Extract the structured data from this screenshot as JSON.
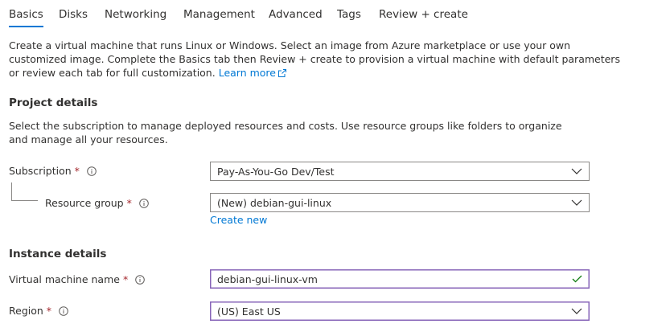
{
  "tabs": [
    {
      "label": "Basics",
      "active": true
    },
    {
      "label": "Disks"
    },
    {
      "label": "Networking"
    },
    {
      "label": "Management"
    },
    {
      "label": "Advanced"
    },
    {
      "label": "Tags"
    },
    {
      "label": "Review + create"
    }
  ],
  "intro": {
    "text": "Create a virtual machine that runs Linux or Windows. Select an image from Azure marketplace or use your own customized image. Complete the Basics tab then Review + create to provision a virtual machine with default parameters or review each tab for full customization.",
    "link": "Learn more"
  },
  "project": {
    "heading": "Project details",
    "description": "Select the subscription to manage deployed resources and costs. Use resource groups like folders to organize and manage all your resources.",
    "subscription": {
      "label": "Subscription",
      "required": "*",
      "value": "Pay-As-You-Go Dev/Test"
    },
    "resource_group": {
      "label": "Resource group",
      "required": "*",
      "value": "(New) debian-gui-linux",
      "create_new": "Create new"
    }
  },
  "instance": {
    "heading": "Instance details",
    "vm_name": {
      "label": "Virtual machine name",
      "required": "*",
      "value": "debian-gui-linux-vm"
    },
    "region": {
      "label": "Region",
      "required": "*",
      "value": "(US) East US"
    }
  },
  "colors": {
    "accent": "#0078d4",
    "required": "#a4262c",
    "focus_border": "#8764b8",
    "valid_check": "#107c10"
  }
}
